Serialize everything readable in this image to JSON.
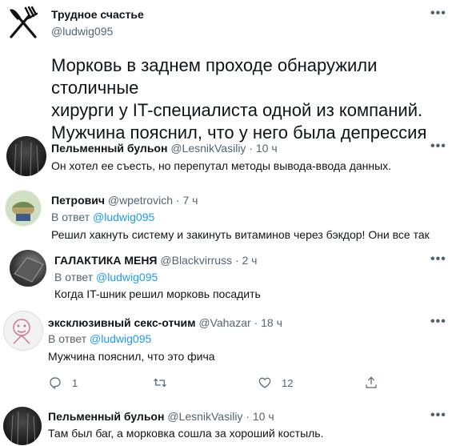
{
  "main_post": {
    "author_name": "Трудное счастье",
    "author_handle": "@ludwig095",
    "text_lines": [
      "Морковь в заднем проходе обнаружили столичные",
      "хирурги у IT-специалиста одной из компаний.",
      "Мужчина пояснил, что у него была депрессия"
    ]
  },
  "replies": [
    {
      "name": "Пельменный бульон",
      "handle": "@LesnikVasiliy",
      "time": "· 10 ч",
      "reply_prefix": "",
      "reply_to": "",
      "text": "Он хотел ее съесть, но перепутал методы вывода-ввода данных."
    },
    {
      "name": "Петрович",
      "handle": "@wpetrovich",
      "time": "· 7 ч",
      "reply_prefix": "В ответ",
      "reply_to": "@ludwig095",
      "text": "Решил хакнуть систему и закинуть витаминов через бэкдор! Они все так"
    },
    {
      "name": "ГАЛАКТИКА МЕНЯ",
      "handle": "@Blackvirruss",
      "time": "· 2 ч",
      "reply_prefix": "В ответ",
      "reply_to": "@ludwig095",
      "text": "Когда IT-шник решил морковь посадить"
    },
    {
      "name": "эксклюзивный секс-отчим",
      "handle": "@Vahazar",
      "time": "· 18 ч",
      "reply_prefix": "В ответ",
      "reply_to": "@ludwig095",
      "text": "Мужчина пояснил, что это фича",
      "actions": {
        "replies": "1",
        "retweets": "",
        "likes": "12"
      }
    },
    {
      "name": "Пельменный бульон",
      "handle": "@LesnikVasiliy",
      "time": "· 10 ч",
      "reply_prefix": "",
      "reply_to": "",
      "text": "Там был баг, а морковка сошла за хороший костыль."
    }
  ],
  "icons": {
    "main_avatar": "crossed-fork-knife-icon",
    "more": "more-options-icon",
    "reply": "reply-icon",
    "retweet": "retweet-icon",
    "like": "heart-icon",
    "share": "share-icon"
  },
  "colors": {
    "link": "#1d9bf0",
    "secondary": "#536471",
    "text": "#0f1419"
  }
}
